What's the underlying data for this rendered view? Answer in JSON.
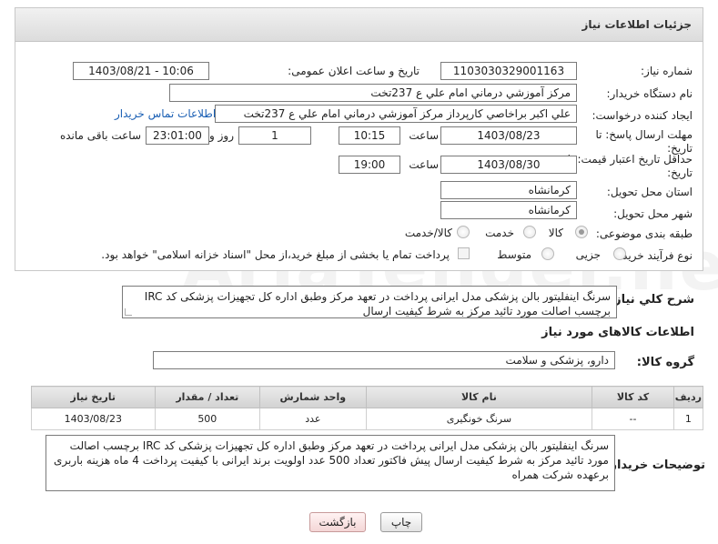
{
  "panel": {
    "title": "جزئیات اطلاعات نیاز"
  },
  "fields": {
    "need_number_label": "شماره نیاز:",
    "need_number": "1103030329001163",
    "announce_label": "تاریخ و ساعت اعلان عمومی:",
    "announce_value": "1403/08/21 - 10:06",
    "buyer_org_label": "نام دستگاه خریدار:",
    "buyer_org": "مرکز آموزشي درماني امام علي ع 237تخت",
    "creator_label": "ایجاد کننده درخواست:",
    "creator": "علي اکبر براخاصي کارپرداز  مرکز آموزشي درماني امام علي ع 237تخت",
    "contact_link": "اطلاعات تماس خریدار",
    "deadline_label_line1": "مهلت ارسال پاسخ: تا",
    "deadline_label_line2": "تاریخ:",
    "deadline_date": "1403/08/23",
    "time_label": "ساعت",
    "deadline_time": "10:15",
    "days_value": "1",
    "days_label": "روز و",
    "remaining_time": "23:01:00",
    "remaining_label": "ساعت باقی مانده",
    "validity_label_line1": "حداقل تاریخ اعتبار قیمت: تا",
    "validity_label_line2": "تاریخ:",
    "validity_date": "1403/08/30",
    "validity_time": "19:00",
    "province_label": "استان محل تحویل:",
    "province": "کرمانشاه",
    "city_label": "شهر محل تحویل:",
    "city": "کرمانشاه",
    "category_label": "طبقه بندی موضوعی:",
    "category_options": [
      "کالا",
      "خدمت",
      "کالا/خدمت"
    ],
    "process_label": "نوع فرآیند خرید :",
    "process_options": [
      "جزیی",
      "متوسط"
    ],
    "process_note": "پرداخت تمام یا بخشی از مبلغ خرید،از محل \"اسناد خزانه اسلامی\" خواهد بود."
  },
  "description": {
    "label": "شرح کلي نیاز:",
    "text": "سرنگ اینفلیتور بالن پزشکی مدل ایرانی  پرداخت در تعهد مرکز وطبق اداره کل تجهیزات پزشکی کد IRC برچسب اصالت مورد تائید مرکز به شرط کیفیت ارسال"
  },
  "goods": {
    "section_title": "اطلاعات کالاهای مورد نیاز",
    "group_label": "گروه کالا:",
    "group_value": "دارو، پزشکی و سلامت",
    "columns": [
      "ردیف",
      "کد کالا",
      "نام کالا",
      "واحد شمارش",
      "تعداد / مقدار",
      "تاریخ نیاز"
    ],
    "rows": [
      {
        "row": "1",
        "code": "--",
        "name": "سرنگ خونگیری",
        "unit": "عدد",
        "qty": "500",
        "date": "1403/08/23"
      }
    ]
  },
  "buyer_notes": {
    "label": "توضیحات خریدار:",
    "text": "سرنگ اینفلیتور بالن پزشکی مدل ایرانی  پرداخت در تعهد مرکز وطبق اداره کل تجهیزات پزشکی کد IRC برچسب اصالت مورد تائید مرکز به شرط کیفیت ارسال پیش فاکتور تعداد 500 عدد اولویت برند ایرانی با کیفیت پرداخت 4 ماه هزینه باربری برعهده شرکت همراه"
  },
  "buttons": {
    "print": "چاپ",
    "back": "بازگشت"
  },
  "watermark": "AriaTender.neT"
}
